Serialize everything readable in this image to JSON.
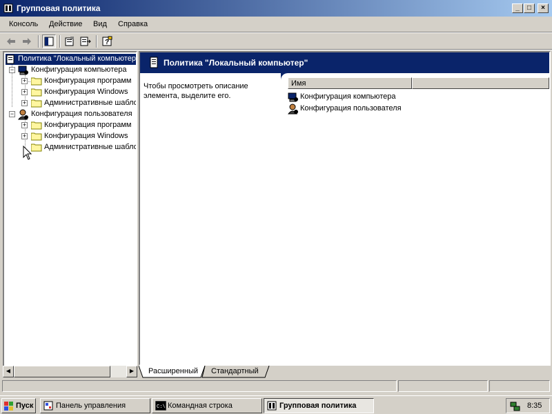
{
  "window": {
    "title": "Групповая политика",
    "controls": {
      "minimize": "_",
      "maximize": "□",
      "close": "×"
    }
  },
  "menu": [
    "Консоль",
    "Действие",
    "Вид",
    "Справка"
  ],
  "toolbar": {
    "icons": [
      "back-arrow-icon",
      "forward-arrow-icon",
      "show-hide-tree-icon",
      "properties-icon",
      "export-list-icon",
      "help-icon"
    ]
  },
  "tree": {
    "root": "Политика \"Локальный компьютер\"",
    "computer": {
      "label": "Конфигурация компьютера",
      "children": [
        "Конфигурация программ",
        "Конфигурация Windows",
        "Административные шаблоны"
      ]
    },
    "user": {
      "label": "Конфигурация пользователя",
      "children": [
        "Конфигурация программ",
        "Конфигурация Windows",
        "Административные шаблоны"
      ]
    }
  },
  "details": {
    "header": "Политика \"Локальный компьютер\"",
    "description": "Чтобы просмотреть описание элемента, выделите его.",
    "column_name": "Имя",
    "items": [
      "Конфигурация компьютера",
      "Конфигурация пользователя"
    ]
  },
  "tabs": [
    "Расширенный",
    "Стандартный"
  ],
  "taskbar": {
    "start": "Пуск",
    "buttons": [
      "Панель управления",
      "Командная строка",
      "Групповая политика"
    ],
    "active": "Групповая политика",
    "clock": "8:35"
  },
  "colors": {
    "title_active": "#0a246a",
    "face": "#d4d0c8"
  }
}
